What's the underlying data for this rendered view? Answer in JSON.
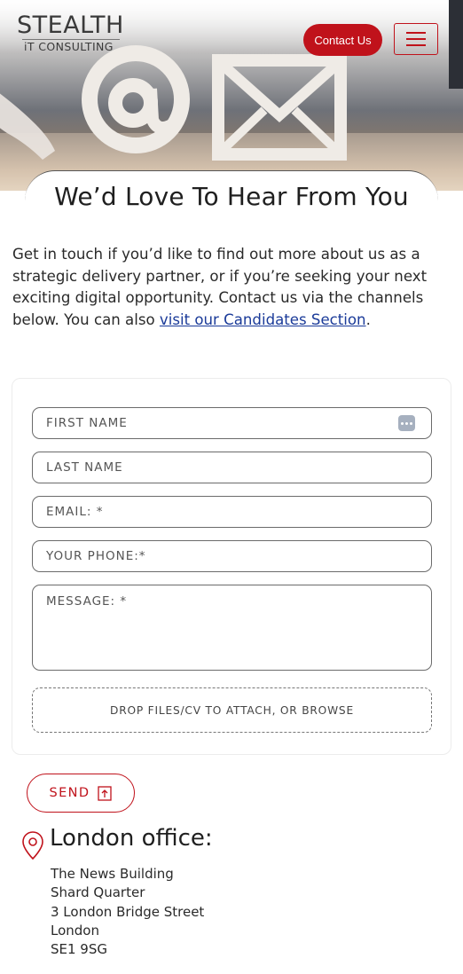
{
  "header": {
    "logo_main": "STEALTH",
    "logo_sub": "iT CONSULTING",
    "contact_label": "Contact Us",
    "menu_icon": "hamburger-menu-icon"
  },
  "hero": {
    "title": "We’d Love To Hear From You"
  },
  "intro": {
    "text": "Get in touch if you’d like to find out more about us as a strategic delivery partner, or if you’re seeking your next exciting digital opportunity. Contact us via the channels below. You can also ",
    "link_text": "visit our Candidates Section",
    "suffix": "."
  },
  "form": {
    "first_name": "FIRST NAME",
    "last_name": "LAST NAME",
    "email": "EMAIL: *",
    "phone": "YOUR PHONE:*",
    "message": "MESSAGE: *",
    "dropzone": "DROP FILES/CV TO ATTACH, OR BROWSE",
    "send_label": "SEND"
  },
  "office": {
    "title": "London office:",
    "lines": [
      "The News Building",
      "Shard Quarter",
      "3 London Bridge Street",
      "London",
      "SE1 9SG"
    ]
  },
  "colors": {
    "accent": "#c0121b",
    "link": "#1b3b99"
  }
}
